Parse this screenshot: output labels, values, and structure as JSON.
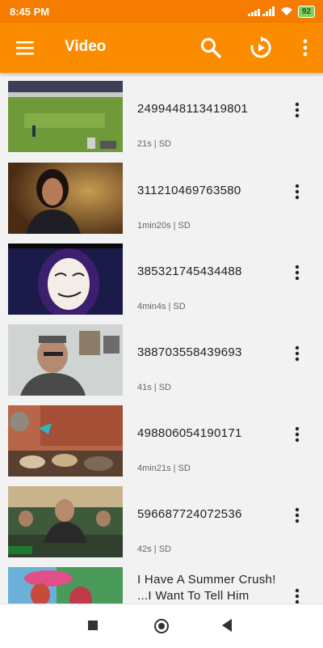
{
  "status_bar": {
    "time": "8:45 PM",
    "battery": "92"
  },
  "app_bar": {
    "title": "Video"
  },
  "videos": [
    {
      "title": "2499448113419801",
      "meta": "21s | SD"
    },
    {
      "title": "311210469763580",
      "meta": "1min20s | SD"
    },
    {
      "title": "385321745434488",
      "meta": "4min4s | SD"
    },
    {
      "title": "388703558439693",
      "meta": "41s | SD"
    },
    {
      "title": "498806054190171",
      "meta": "4min21s | SD"
    },
    {
      "title": "596687724072536",
      "meta": "42s | SD"
    },
    {
      "title": "I Have A Summer Crush! ...I Want To Tell Him While",
      "meta": ""
    }
  ],
  "colors": {
    "status_bar": "#f57c00",
    "app_bar": "#fb8c00",
    "background": "#f2f2f2"
  }
}
